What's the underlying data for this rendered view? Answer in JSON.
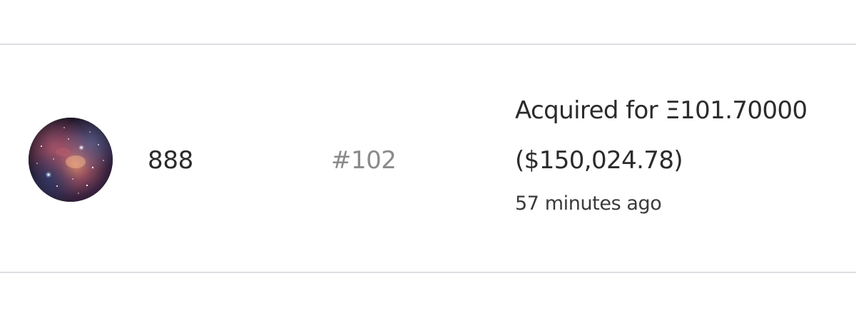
{
  "activity_row": {
    "avatar_icon": "nebula-avatar-icon",
    "name": "888",
    "token_id": "#102",
    "sale": {
      "acquired_prefix": "Acquired for ",
      "currency_symbol": "Ξ",
      "eth_amount": "101.70000",
      "usd_amount": "($150,024.78)",
      "time_ago": "57 minutes ago"
    }
  },
  "colors": {
    "divider": "#dedde3",
    "text_primary": "#2b2b2b",
    "text_muted": "#8a8a8a",
    "background": "#ffffff"
  }
}
